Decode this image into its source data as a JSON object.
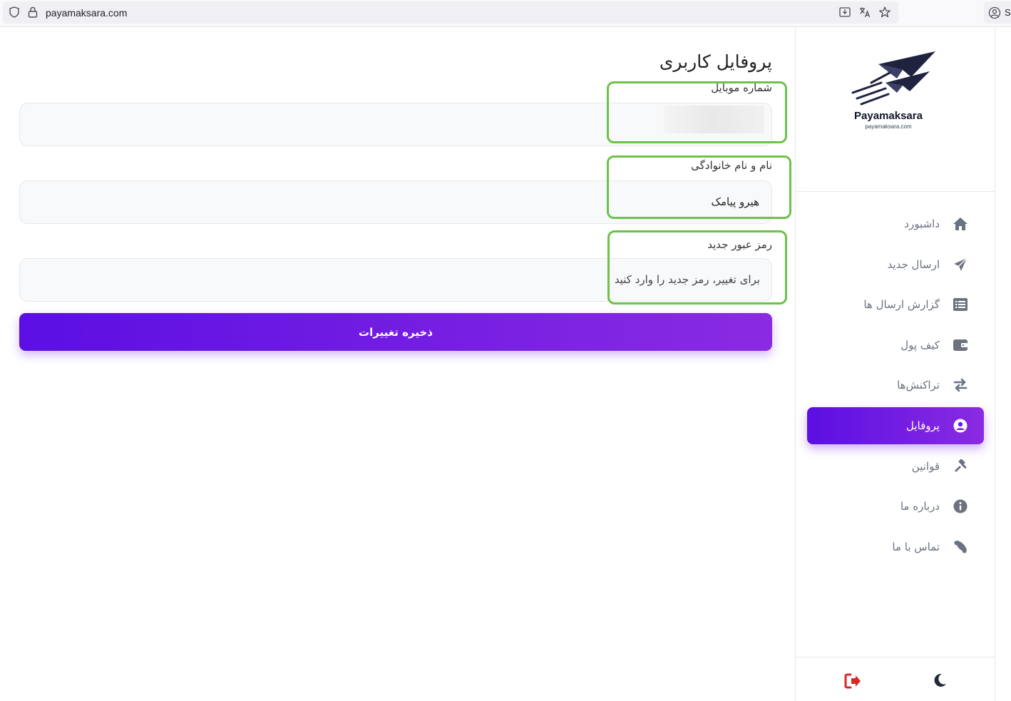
{
  "browser": {
    "url": "payamaksara.com",
    "account_label": "Si"
  },
  "brand": {
    "name": "Payamaksara",
    "domain": "payamaksara.com"
  },
  "nav": {
    "items": [
      {
        "label": "داشبورد",
        "icon": "home-icon"
      },
      {
        "label": "ارسال جدید",
        "icon": "paper-plane-icon"
      },
      {
        "label": "گزارش ارسال ها",
        "icon": "list-icon"
      },
      {
        "label": "کیف پول",
        "icon": "wallet-icon"
      },
      {
        "label": "تراکنش‌ها",
        "icon": "exchange-icon"
      },
      {
        "label": "پروفایل",
        "icon": "user-circle-icon",
        "active": true
      },
      {
        "label": "قوانین",
        "icon": "gavel-icon"
      },
      {
        "label": "درباره ما",
        "icon": "info-icon"
      },
      {
        "label": "تماس با ما",
        "icon": "phone-icon"
      }
    ]
  },
  "footer": {
    "logout_icon": "logout-icon",
    "theme_icon": "moon-icon",
    "logout_color": "#dc2626"
  },
  "profile": {
    "title": "پروفایل کاربری",
    "mobile": {
      "label": "شماره موبایل",
      "value": ""
    },
    "fullname": {
      "label": "نام و نام خانوادگی",
      "value": "هیرو پیامک"
    },
    "password": {
      "label": "رمز عبور جدید",
      "placeholder": "برای تغییر، رمز جدید را وارد کنید"
    },
    "save_label": "ذخیره تغییرات"
  },
  "colors": {
    "accent_start": "#5b0fe3",
    "accent_end": "#8a2be2",
    "highlight": "#6cc24a"
  }
}
